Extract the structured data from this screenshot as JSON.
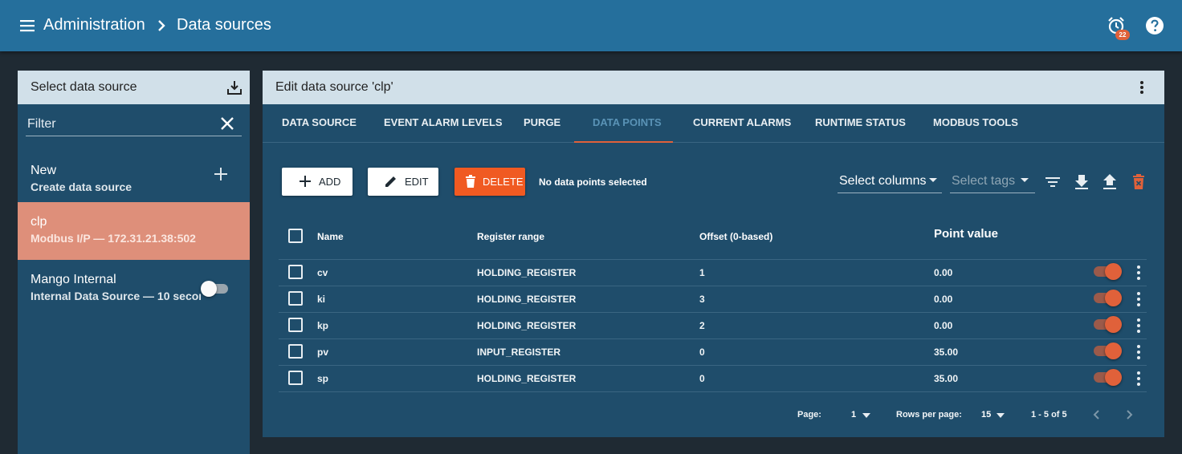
{
  "topbar": {
    "breadcrumb_root": "Administration",
    "breadcrumb_current": "Data sources",
    "alarm_count": "22"
  },
  "left": {
    "title": "Select data source",
    "filter_label": "Filter",
    "items": [
      {
        "title": "New",
        "subtitle": "Create data source"
      },
      {
        "title": "clp",
        "subtitle": "Modbus I/P — 172.31.21.38:502"
      },
      {
        "title": "Mango Internal",
        "subtitle": "Internal Data Source — 10 seconds"
      }
    ]
  },
  "right": {
    "title": "Edit data source 'clp'",
    "tabs": [
      "DATA SOURCE",
      "EVENT ALARM LEVELS",
      "PURGE",
      "DATA POINTS",
      "CURRENT ALARMS",
      "RUNTIME STATUS",
      "MODBUS TOOLS"
    ],
    "active_tab": "DATA POINTS"
  },
  "toolbar": {
    "add_label": "ADD",
    "edit_label": "EDIT",
    "delete_label": "DELETE",
    "selection_status": "No data points selected",
    "columns_select": "Select columns",
    "tags_select": "Select tags"
  },
  "table": {
    "headers": {
      "name": "Name",
      "register_range": "Register range",
      "offset": "Offset (0-based)",
      "point_value": "Point value"
    },
    "rows": [
      {
        "name": "cv",
        "register_range": "HOLDING_REGISTER",
        "offset": "1",
        "point_value": "0.00",
        "enabled": true
      },
      {
        "name": "ki",
        "register_range": "HOLDING_REGISTER",
        "offset": "3",
        "point_value": "0.00",
        "enabled": true
      },
      {
        "name": "kp",
        "register_range": "HOLDING_REGISTER",
        "offset": "2",
        "point_value": "0.00",
        "enabled": true
      },
      {
        "name": "pv",
        "register_range": "INPUT_REGISTER",
        "offset": "0",
        "point_value": "35.00",
        "enabled": true
      },
      {
        "name": "sp",
        "register_range": "HOLDING_REGISTER",
        "offset": "0",
        "point_value": "35.00",
        "enabled": true
      }
    ]
  },
  "pager": {
    "page_label": "Page:",
    "page_value": "1",
    "rows_label": "Rows per page:",
    "rows_value": "15",
    "range_text": "1 - 5 of 5"
  },
  "colors": {
    "topbar": "#256f9c",
    "panel": "#1f4d6b",
    "panel_header": "#d1e0e9",
    "accent": "#e0613a",
    "delete_button": "#f05a22",
    "selected_item": "#de8f7a"
  }
}
